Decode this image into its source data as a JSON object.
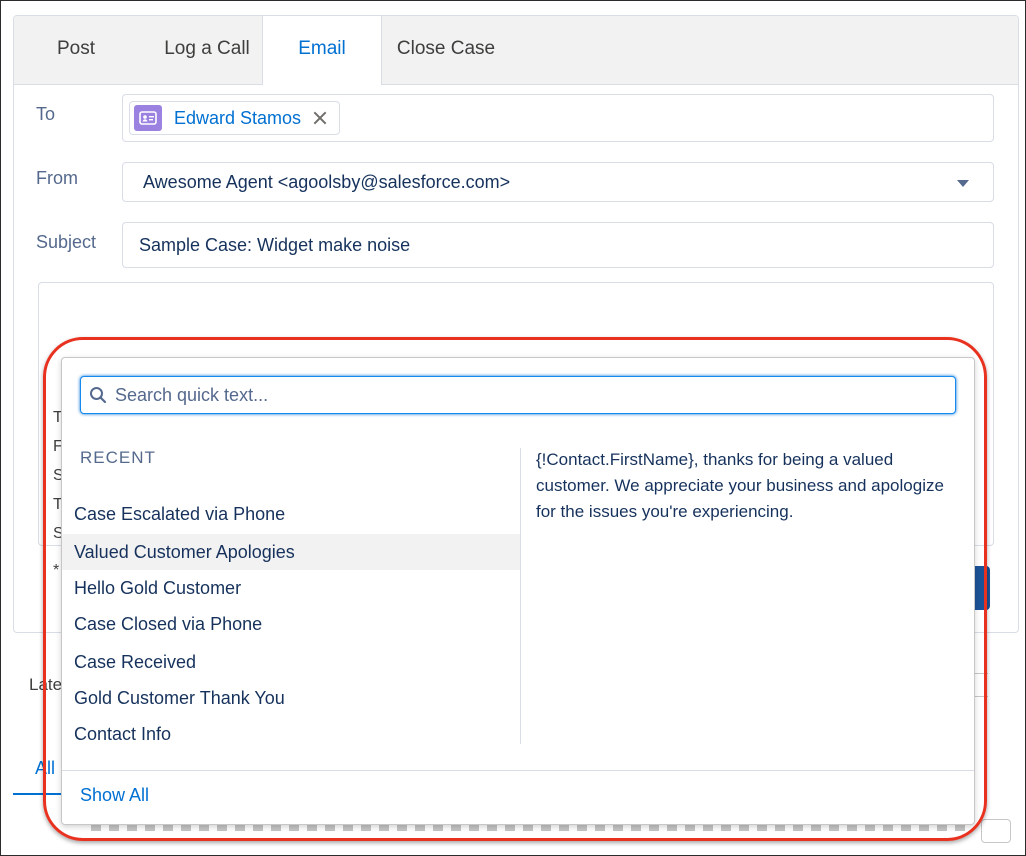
{
  "tabs": [
    {
      "label": "Post"
    },
    {
      "label": "Log a Call"
    },
    {
      "label": "Email",
      "active": true
    },
    {
      "label": "Close Case"
    }
  ],
  "email": {
    "to_label": "To",
    "to_recipient": "Edward Stamos",
    "from_label": "From",
    "from_value": "Awesome Agent <agoolsby@salesforce.com>",
    "subject_label": "Subject",
    "subject_value": "Sample Case: Widget make noise",
    "body_fragments": [
      "T",
      "F",
      "S",
      "T",
      "S",
      "*"
    ]
  },
  "background": {
    "latest_label": "Late",
    "all_tab": "All"
  },
  "quick_text": {
    "search_placeholder": "Search quick text...",
    "recent_heading": "RECENT",
    "items": [
      "Case Escalated via Phone",
      "Valued Customer Apologies",
      "Hello Gold Customer",
      "Case Closed via Phone",
      "Case Received",
      "Gold Customer Thank You",
      "Contact Info"
    ],
    "selected_index": 1,
    "preview_text": "{!Contact.FirstName}, thanks for being a valued customer. We appreciate your business and apologize for the issues you're experiencing.",
    "show_all": "Show All"
  },
  "colors": {
    "link_blue": "#0070d2",
    "highlight_red": "#e8321f",
    "contact_avatar": "#9b82e1"
  }
}
